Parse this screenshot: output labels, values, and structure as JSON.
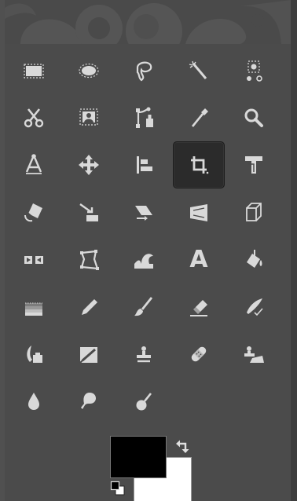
{
  "toolbox": {
    "rows": [
      [
        {
          "name": "rect-select",
          "icon": "rect-select-icon"
        },
        {
          "name": "ellipse-select",
          "icon": "ellipse-select-icon"
        },
        {
          "name": "free-select",
          "icon": "free-select-icon"
        },
        {
          "name": "fuzzy-select",
          "icon": "fuzzy-select-icon"
        },
        {
          "name": "select-by-color",
          "icon": "select-by-color-icon"
        }
      ],
      [
        {
          "name": "scissors-select",
          "icon": "scissors-select-icon"
        },
        {
          "name": "foreground-select",
          "icon": "foreground-select-icon"
        },
        {
          "name": "paths",
          "icon": "paths-icon"
        },
        {
          "name": "color-picker",
          "icon": "color-picker-icon"
        },
        {
          "name": "zoom",
          "icon": "zoom-icon"
        }
      ],
      [
        {
          "name": "measure",
          "icon": "measure-icon"
        },
        {
          "name": "move",
          "icon": "move-icon"
        },
        {
          "name": "align",
          "icon": "align-icon"
        },
        {
          "name": "crop",
          "icon": "crop-icon",
          "active": true
        },
        {
          "name": "unified-transform",
          "icon": "unified-transform-icon"
        }
      ],
      [
        {
          "name": "rotate",
          "icon": "rotate-icon"
        },
        {
          "name": "scale",
          "icon": "scale-icon"
        },
        {
          "name": "shear",
          "icon": "shear-icon"
        },
        {
          "name": "perspective",
          "icon": "perspective-icon"
        },
        {
          "name": "3d-transform",
          "icon": "3d-transform-icon"
        }
      ],
      [
        {
          "name": "flip",
          "icon": "flip-icon"
        },
        {
          "name": "cage-transform",
          "icon": "cage-transform-icon"
        },
        {
          "name": "warp-transform",
          "icon": "warp-transform-icon"
        },
        {
          "name": "text",
          "icon": "text-icon",
          "glyph": "A"
        },
        {
          "name": "bucket-fill",
          "icon": "bucket-fill-icon"
        }
      ],
      [
        {
          "name": "gradient",
          "icon": "gradient-icon"
        },
        {
          "name": "pencil",
          "icon": "pencil-icon"
        },
        {
          "name": "paintbrush",
          "icon": "paintbrush-icon"
        },
        {
          "name": "eraser",
          "icon": "eraser-icon"
        },
        {
          "name": "airbrush",
          "icon": "airbrush-icon"
        }
      ],
      [
        {
          "name": "ink",
          "icon": "ink-icon"
        },
        {
          "name": "mypaint-brush",
          "icon": "mypaint-brush-icon"
        },
        {
          "name": "clone",
          "icon": "clone-icon"
        },
        {
          "name": "heal",
          "icon": "heal-icon"
        },
        {
          "name": "perspective-clone",
          "icon": "perspective-clone-icon"
        }
      ],
      [
        {
          "name": "blur-sharpen",
          "icon": "blur-sharpen-icon"
        },
        {
          "name": "smudge",
          "icon": "smudge-icon"
        },
        {
          "name": "dodge-burn",
          "icon": "dodge-burn-icon"
        }
      ]
    ]
  },
  "colors": {
    "foreground": "#000000",
    "background": "#ffffff",
    "icon_color": "#d9d9d9",
    "active_tool_bg": "#2b2b2b",
    "panel_bg": "#4b4b4b"
  }
}
